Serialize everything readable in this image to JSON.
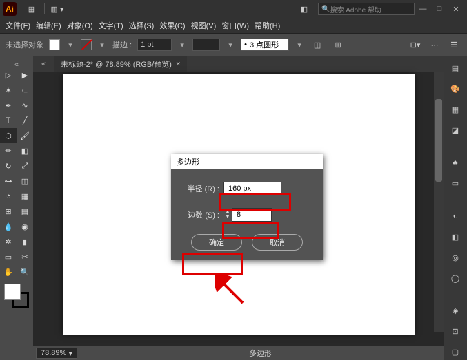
{
  "app_logo": "Ai",
  "search_placeholder": "搜索 Adobe 帮助",
  "menu": {
    "file": "文件(F)",
    "edit": "编辑(E)",
    "object": "对象(O)",
    "type": "文字(T)",
    "select": "选择(S)",
    "effect": "效果(C)",
    "view": "视图(V)",
    "window": "窗口(W)",
    "help": "帮助(H)"
  },
  "options": {
    "no_selection": "未选择对象",
    "stroke_label": "描边 :",
    "stroke_value": "1 pt",
    "profile_value": "3 点圆形"
  },
  "tab": {
    "title": "未标题-2* @ 78.89% (RGB/预览)",
    "close": "×"
  },
  "status": {
    "zoom": "78.89%",
    "text": "多边形"
  },
  "dialog": {
    "title": "多边形",
    "radius_label": "半径 (R) :",
    "radius_value": "160 px",
    "sides_label": "边数 (S) :",
    "sides_value": "8",
    "ok": "确定",
    "cancel": "取消"
  }
}
